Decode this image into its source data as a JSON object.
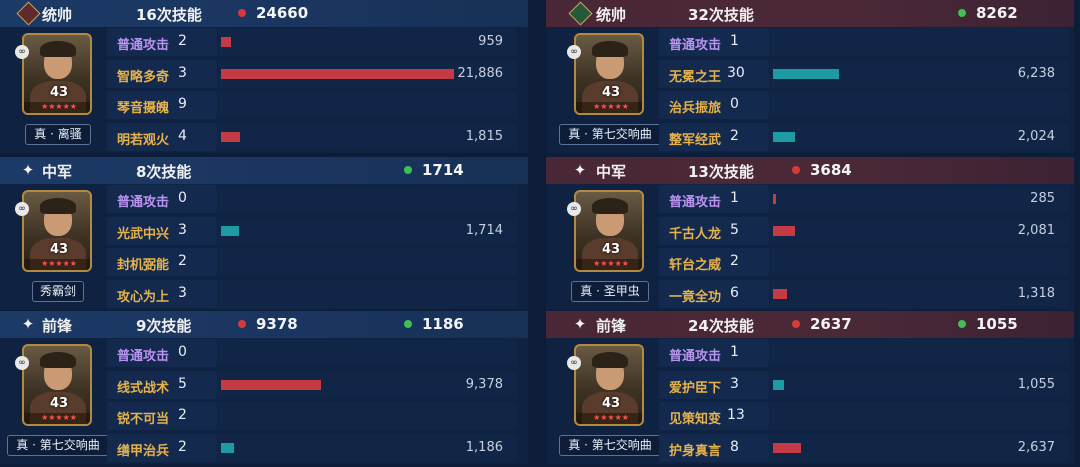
{
  "colors": {
    "damage": "#c43b45",
    "heal": "#1e9aa2",
    "basic_attack": "#b993f0",
    "skill": "#e6b24c"
  },
  "teams": [
    {
      "side": "left",
      "groups": [
        {
          "role": "统帅",
          "role_icon": "diamond-red-icon",
          "skill_count": "16次技能",
          "damage_total": "24660",
          "heal_total": "",
          "hero": {
            "name": "真 · 离骚",
            "level": "43"
          },
          "skills": [
            {
              "name": "普通攻击",
              "count": "2",
              "value": "959",
              "bar_type": "damage",
              "fill": 0.034
            },
            {
              "name": "智略多奇",
              "count": "3",
              "value": "21,886",
              "bar_type": "damage",
              "fill": 0.78
            },
            {
              "name": "琴音摄魄",
              "count": "9",
              "value": "",
              "bar_type": "damage",
              "fill": 0
            },
            {
              "name": "明若观火",
              "count": "4",
              "value": "1,815",
              "bar_type": "damage",
              "fill": 0.065
            }
          ]
        },
        {
          "role": "中军",
          "role_icon": "sparkle-icon",
          "skill_count": "8次技能",
          "damage_total": "",
          "heal_total": "1714",
          "hero": {
            "name": "秀霸剑",
            "level": "43"
          },
          "skills": [
            {
              "name": "普通攻击",
              "count": "0",
              "value": "",
              "bar_type": "damage",
              "fill": 0
            },
            {
              "name": "光武中兴",
              "count": "3",
              "value": "1,714",
              "bar_type": "heal",
              "fill": 0.061
            },
            {
              "name": "封机弼能",
              "count": "2",
              "value": "",
              "bar_type": "damage",
              "fill": 0
            },
            {
              "name": "攻心为上",
              "count": "3",
              "value": "",
              "bar_type": "damage",
              "fill": 0
            }
          ]
        },
        {
          "role": "前锋",
          "role_icon": "sparkle-icon",
          "skill_count": "9次技能",
          "damage_total": "9378",
          "heal_total": "1186",
          "hero": {
            "name": "真 · 第七交响曲",
            "level": "43"
          },
          "skills": [
            {
              "name": "普通攻击",
              "count": "0",
              "value": "",
              "bar_type": "damage",
              "fill": 0
            },
            {
              "name": "线式战术",
              "count": "5",
              "value": "9,378",
              "bar_type": "damage",
              "fill": 0.334
            },
            {
              "name": "锐不可当",
              "count": "2",
              "value": "",
              "bar_type": "damage",
              "fill": 0
            },
            {
              "name": "缮甲治兵",
              "count": "2",
              "value": "1,186",
              "bar_type": "heal",
              "fill": 0.042
            }
          ]
        }
      ]
    },
    {
      "side": "right",
      "groups": [
        {
          "role": "统帅",
          "role_icon": "diamond-green-icon",
          "skill_count": "32次技能",
          "damage_total": "",
          "heal_total": "8262",
          "hero": {
            "name": "真 · 第七交响曲",
            "level": "43"
          },
          "skills": [
            {
              "name": "普通攻击",
              "count": "1",
              "value": "",
              "bar_type": "damage",
              "fill": 0
            },
            {
              "name": "无冕之王",
              "count": "30",
              "value": "6,238",
              "bar_type": "heal",
              "fill": 0.222
            },
            {
              "name": "治兵振旅",
              "count": "0",
              "value": "",
              "bar_type": "damage",
              "fill": 0
            },
            {
              "name": "整军经武",
              "count": "2",
              "value": "2,024",
              "bar_type": "heal",
              "fill": 0.072
            }
          ]
        },
        {
          "role": "中军",
          "role_icon": "sparkle-icon",
          "skill_count": "13次技能",
          "damage_total": "3684",
          "heal_total": "",
          "hero": {
            "name": "真 · 圣甲虫",
            "level": "43"
          },
          "skills": [
            {
              "name": "普通攻击",
              "count": "1",
              "value": "285",
              "bar_type": "damage",
              "fill": 0.01
            },
            {
              "name": "千古人龙",
              "count": "5",
              "value": "2,081",
              "bar_type": "damage",
              "fill": 0.074
            },
            {
              "name": "轩台之威",
              "count": "2",
              "value": "",
              "bar_type": "damage",
              "fill": 0
            },
            {
              "name": "一竟全功",
              "count": "6",
              "value": "1,318",
              "bar_type": "damage",
              "fill": 0.047
            }
          ]
        },
        {
          "role": "前锋",
          "role_icon": "sparkle-icon",
          "skill_count": "24次技能",
          "damage_total": "2637",
          "heal_total": "1055",
          "hero": {
            "name": "真 · 第七交响曲",
            "level": "43"
          },
          "skills": [
            {
              "name": "普通攻击",
              "count": "1",
              "value": "",
              "bar_type": "damage",
              "fill": 0
            },
            {
              "name": "爱护臣下",
              "count": "3",
              "value": "1,055",
              "bar_type": "heal",
              "fill": 0.038
            },
            {
              "name": "见策知变",
              "count": "13",
              "value": "",
              "bar_type": "damage",
              "fill": 0
            },
            {
              "name": "护身真言",
              "count": "8",
              "value": "2,637",
              "bar_type": "damage",
              "fill": 0.094
            }
          ]
        }
      ]
    }
  ]
}
